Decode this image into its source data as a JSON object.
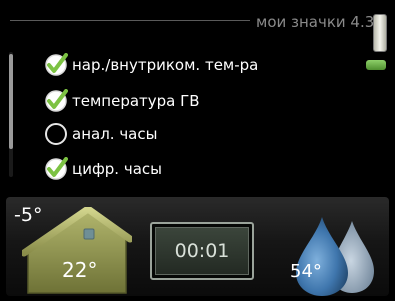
{
  "header": {
    "title": "мои значки 4.3"
  },
  "menu": {
    "items": [
      {
        "label": "нар./внутриком. тем-ра",
        "checked": true
      },
      {
        "label": "температура ГВ",
        "checked": true
      },
      {
        "label": "анал. часы",
        "checked": false
      },
      {
        "label": "цифр. часы",
        "checked": true
      }
    ]
  },
  "status": {
    "outdoor_temp": "-5°",
    "indoor_temp": "22°",
    "clock_time": "00:01",
    "hot_water_temp": "54°"
  },
  "colors": {
    "check_green": "#7cc243",
    "page_indicator": "#6bb24a",
    "house": "#8e9254",
    "water_drop": "#4f83b8"
  }
}
